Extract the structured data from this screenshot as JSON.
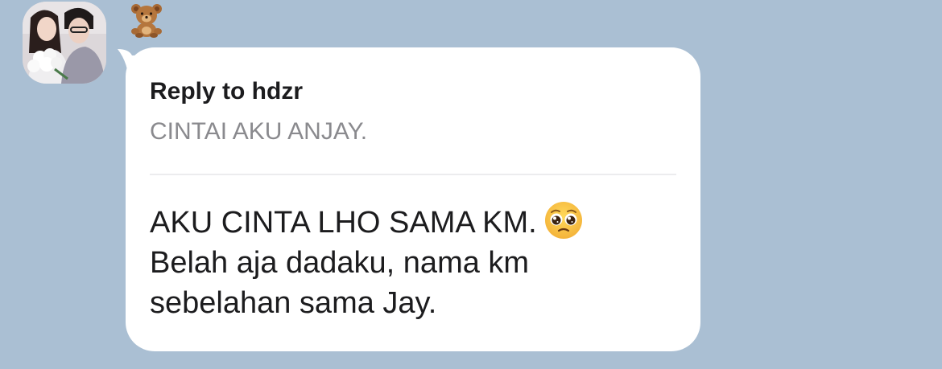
{
  "chat": {
    "sender": {
      "avatar_icon": "profile-photo-couple",
      "name_emoji_icon": "teddy-bear-emoji"
    },
    "message": {
      "reply": {
        "title": "Reply to hdzr",
        "snippet": "CINTAI AKU ANJAY."
      },
      "lines": [
        "AKU CINTA LHO SAMA KM.",
        "Belah aja dadaku, nama km",
        "sebelahan sama Jay."
      ],
      "emoji_icon": "pleading-face-emoji"
    }
  },
  "colors": {
    "background": "#aabfd3",
    "bubble": "#ffffff",
    "text": "#1c1c1e",
    "secondary_text": "#8a8a8e"
  }
}
